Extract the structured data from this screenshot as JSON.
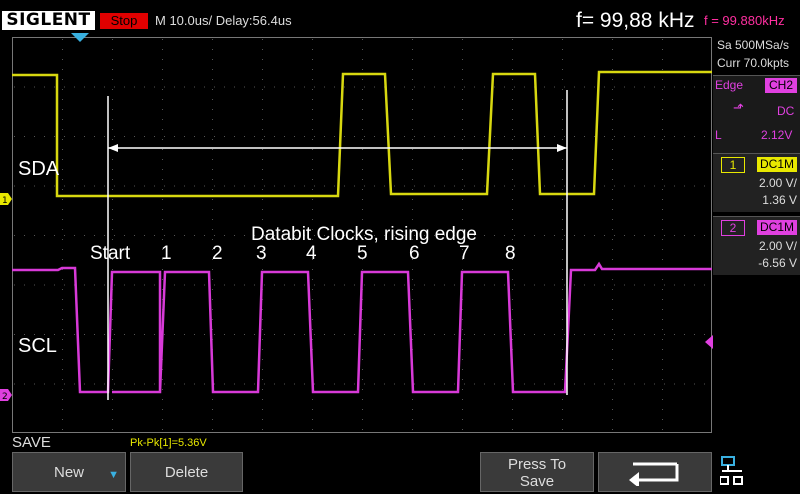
{
  "header": {
    "brand": "SIGLENT",
    "run_state": "Stop",
    "timebase": "M 10.0us/  Delay:56.4us",
    "frequency": "f= 99,88 kHz",
    "frequency_small": "f = 99.880kHz"
  },
  "acquisition": {
    "sample_rate": "Sa 500MSa/s",
    "memory": "Curr 70.0kpts"
  },
  "trigger": {
    "type": "Edge",
    "source": "CH2",
    "coupling": "DC",
    "level_label": "L",
    "level": "2.12V"
  },
  "channels": [
    {
      "number": "1",
      "coupling": "DC1M",
      "scale": "2.00 V/",
      "offset": "1.36 V",
      "color": "#e8e800"
    },
    {
      "number": "2",
      "coupling": "DC1M",
      "scale": "2.00 V/",
      "offset": "-6.56 V",
      "color": "#e040e0"
    }
  ],
  "annotations": {
    "sda": "SDA",
    "scl": "SCL",
    "title": "Databit Clocks, rising edge",
    "start": "Start",
    "bits": [
      "1",
      "2",
      "3",
      "4",
      "5",
      "6",
      "7",
      "8"
    ]
  },
  "bottom": {
    "mode": "SAVE",
    "measurement": "Pk-Pk[1]=5.36V",
    "softkeys": {
      "new": "New",
      "delete": "Delete",
      "press_to": "Press To",
      "save": "Save"
    }
  }
}
